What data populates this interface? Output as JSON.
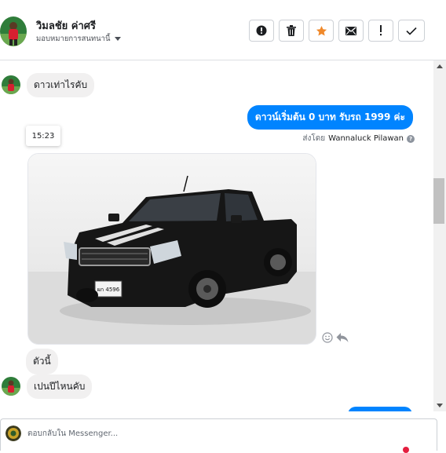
{
  "header": {
    "contact_name": "วิมลชัย ค่าศรี",
    "assign_label": "มอบหมายการสนทนานี้",
    "actions": [
      {
        "icon": "alert-circle-icon",
        "label": "Mark as spam"
      },
      {
        "icon": "trash-icon",
        "label": "Delete"
      },
      {
        "icon": "star-icon",
        "label": "Star"
      },
      {
        "icon": "envelope-icon",
        "label": "Mark as unread"
      },
      {
        "icon": "exclamation-icon",
        "label": "Follow up"
      },
      {
        "icon": "check-icon",
        "label": "Done"
      }
    ],
    "accent_star": "#f0892b"
  },
  "thread": {
    "messages": [
      {
        "from": "customer",
        "text": "ดาวเท่าไรคับ"
      },
      {
        "from": "page",
        "text": "ดาวน์เริ่มต้น 0 บาท รับรถ 1999 ค่ะ"
      },
      {
        "from": "page",
        "type": "image",
        "description": "black pickup truck"
      },
      {
        "from": "customer",
        "text": "ตัวนี้"
      },
      {
        "from": "customer",
        "text": "เปนปีไหนคับ"
      }
    ],
    "time_chip": "15:23",
    "sent_by_prefix": "ส่งโดย",
    "sent_by_name": "Wannaluck Pilawan",
    "plate_text": "ผก 4596"
  },
  "composer": {
    "placeholder": "ตอบกลับใน Messenger..."
  },
  "colors": {
    "outgoing_bubble": "#0084ff",
    "incoming_bubble": "#f1f0f0"
  }
}
